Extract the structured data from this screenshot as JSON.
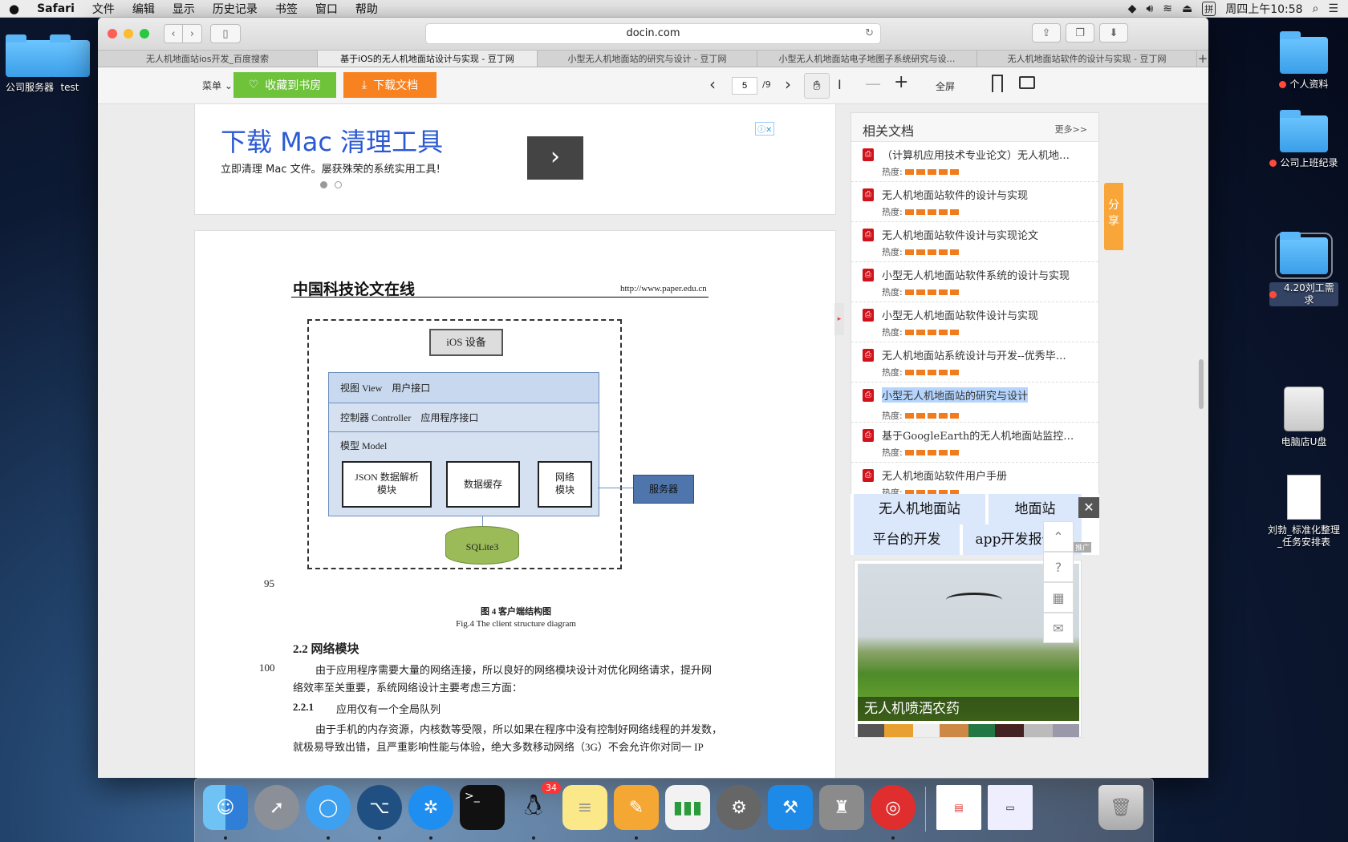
{
  "menubar": {
    "apple": "",
    "app": "Safari",
    "items": [
      "文件",
      "编辑",
      "显示",
      "历史记录",
      "书签",
      "窗口",
      "帮助"
    ],
    "clock": "周四上午10:58"
  },
  "desktop": {
    "left": [
      {
        "label": "公司服务器"
      },
      {
        "label": "test"
      }
    ],
    "right": [
      {
        "label": "个人资料",
        "dot": true
      },
      {
        "label": "公司上班纪录",
        "dot": true
      },
      {
        "label": "4.20刘工需求",
        "dot": true
      },
      {
        "label": "电脑店U盘"
      },
      {
        "label": "刘勃_标准化整理_任务安排表"
      }
    ]
  },
  "browser": {
    "url": "docin.com",
    "tabs": [
      "无人机地面站ios开发_百度搜索",
      "基于iOS的无人机地面站设计与实现 - 豆丁网",
      "小型无人机地面站的研究与设计 - 豆丁网",
      "小型无人机地面站电子地图子系统研究与设…",
      "无人机地面站软件的设计与实现 - 豆丁网"
    ],
    "active_tab": 1
  },
  "toolbar": {
    "menu": "菜单",
    "collect": "收藏到书房",
    "download": "下载文档",
    "page_current": "5",
    "page_total": "/9",
    "fullscreen": "全屏"
  },
  "ad": {
    "title": "下载 Mac 清理工具",
    "subtitle": "立即清理 Mac 文件。屡获殊荣的系统实用工具!"
  },
  "doc": {
    "logo": "中国科技论文在线",
    "site": "http://www.paper.edu.cn",
    "diagram": {
      "ios": "iOS 设备",
      "view": "视图 View    用户接口",
      "controller": "控制器 Controller    应用程序接口",
      "model": "模型 Model",
      "json": "JSON 数据解析\n模块",
      "cache": "数据缓存",
      "net": "网络\n模块",
      "server": "服务器",
      "sqlite": "SQLite3"
    },
    "line95": "95",
    "fig_cn": "图 4  客户端结构图",
    "fig_en": "Fig.4 The client structure diagram",
    "h22": "2.2 网络模块",
    "line100": "100",
    "p1a": "由于应用程序需要大量的网络连接，所以良好的网络模块设计对优化网络请求，提升网",
    "p1b": "络效率至关重要，系统网络设计主要考虑三方面：",
    "h221_num": "2.2.1",
    "h221": "应用仅有一个全局队列",
    "p2a": "由于手机的内存资源，内核数等受限，所以如果在程序中没有控制好网络线程的并发数，",
    "p2b": "就极易导致出错，且严重影响性能与体验，绝大多数移动网络（3G）不会允许你对同一  IP"
  },
  "related": {
    "title": "相关文档",
    "more": "更多>>",
    "heat_label": "热度:",
    "items": [
      "（计算机应用技术专业论文）无人机地…",
      "无人机地面站软件的设计与实现",
      "无人机地面站软件设计与实现论文",
      "小型无人机地面站软件系统的设计与实现",
      "小型无人机地面站软件设计与实现",
      "无人机地面站系统设计与开发--优秀毕…",
      "小型无人机地面站的研究与设计",
      "基于GoogleEarth的无人机地面站监控…",
      "无人机地面站软件用户手册"
    ],
    "highlighted": 6
  },
  "keywords": [
    "无人机地面站",
    "地面站",
    "平台的开发",
    "app开发报价单"
  ],
  "promo_tag": "推广",
  "image_caption": "无人机喷洒农药",
  "share": "分享",
  "dock": {
    "qq_badge": "34"
  }
}
